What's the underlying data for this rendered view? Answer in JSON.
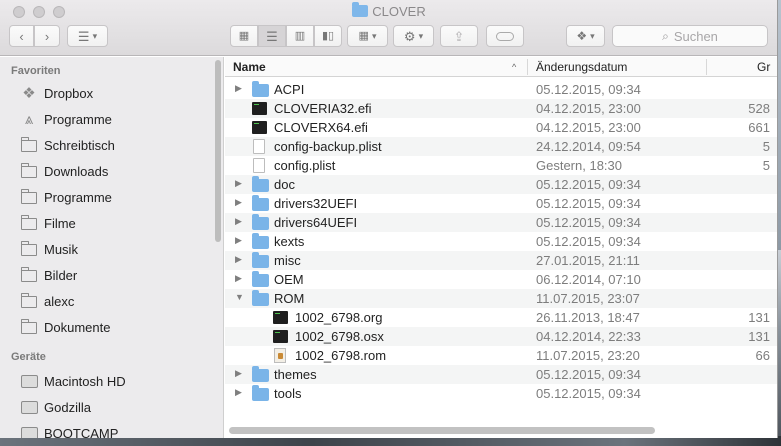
{
  "window": {
    "title": "CLOVER"
  },
  "toolbar": {
    "search_placeholder": "Suchen"
  },
  "sidebar": {
    "favorites_header": "Favoriten",
    "favorites": [
      {
        "label": "Dropbox",
        "icon": "dropbox-icon"
      },
      {
        "label": "Programme",
        "icon": "applications-icon"
      },
      {
        "label": "Schreibtisch",
        "icon": "folder-icon"
      },
      {
        "label": "Downloads",
        "icon": "folder-icon"
      },
      {
        "label": "Programme",
        "icon": "folder-icon"
      },
      {
        "label": "Filme",
        "icon": "folder-icon"
      },
      {
        "label": "Musik",
        "icon": "folder-icon"
      },
      {
        "label": "Bilder",
        "icon": "folder-icon"
      },
      {
        "label": "alexc",
        "icon": "folder-icon"
      },
      {
        "label": "Dokumente",
        "icon": "folder-icon"
      }
    ],
    "devices_header": "Geräte",
    "devices": [
      {
        "label": "Macintosh HD",
        "icon": "disk-icon"
      },
      {
        "label": "Godzilla",
        "icon": "disk-icon"
      },
      {
        "label": "BOOTCAMP",
        "icon": "disk-icon"
      }
    ]
  },
  "columns": {
    "name": "Name",
    "date": "Änderungsdatum",
    "size": "Gr"
  },
  "files": [
    {
      "name": "ACPI",
      "date": "05.12.2015, 09:34",
      "size": "",
      "type": "folder",
      "level": 0,
      "disclosure": "collapsed"
    },
    {
      "name": "CLOVERIA32.efi",
      "date": "04.12.2015, 23:00",
      "size": "528",
      "type": "exec",
      "level": 0,
      "disclosure": ""
    },
    {
      "name": "CLOVERX64.efi",
      "date": "04.12.2015, 23:00",
      "size": "661",
      "type": "exec",
      "level": 0,
      "disclosure": ""
    },
    {
      "name": "config-backup.plist",
      "date": "24.12.2014, 09:54",
      "size": "5",
      "type": "doc",
      "level": 0,
      "disclosure": ""
    },
    {
      "name": "config.plist",
      "date": "Gestern, 18:30",
      "size": "5",
      "type": "doc",
      "level": 0,
      "disclosure": ""
    },
    {
      "name": "doc",
      "date": "05.12.2015, 09:34",
      "size": "",
      "type": "folder",
      "level": 0,
      "disclosure": "collapsed"
    },
    {
      "name": "drivers32UEFI",
      "date": "05.12.2015, 09:34",
      "size": "",
      "type": "folder",
      "level": 0,
      "disclosure": "collapsed"
    },
    {
      "name": "drivers64UEFI",
      "date": "05.12.2015, 09:34",
      "size": "",
      "type": "folder",
      "level": 0,
      "disclosure": "collapsed"
    },
    {
      "name": "kexts",
      "date": "05.12.2015, 09:34",
      "size": "",
      "type": "folder",
      "level": 0,
      "disclosure": "collapsed"
    },
    {
      "name": "misc",
      "date": "27.01.2015, 21:11",
      "size": "",
      "type": "folder",
      "level": 0,
      "disclosure": "collapsed"
    },
    {
      "name": "OEM",
      "date": "06.12.2014, 07:10",
      "size": "",
      "type": "folder",
      "level": 0,
      "disclosure": "collapsed"
    },
    {
      "name": "ROM",
      "date": "11.07.2015, 23:07",
      "size": "",
      "type": "folder",
      "level": 0,
      "disclosure": "expanded"
    },
    {
      "name": "1002_6798.org",
      "date": "26.11.2013, 18:47",
      "size": "131",
      "type": "exec",
      "level": 1,
      "disclosure": ""
    },
    {
      "name": "1002_6798.osx",
      "date": "04.12.2014, 22:33",
      "size": "131",
      "type": "exec",
      "level": 1,
      "disclosure": ""
    },
    {
      "name": "1002_6798.rom",
      "date": "11.07.2015, 23:20",
      "size": "66",
      "type": "rom",
      "level": 1,
      "disclosure": ""
    },
    {
      "name": "themes",
      "date": "05.12.2015, 09:34",
      "size": "",
      "type": "folder",
      "level": 0,
      "disclosure": "collapsed"
    },
    {
      "name": "tools",
      "date": "05.12.2015, 09:34",
      "size": "",
      "type": "folder",
      "level": 0,
      "disclosure": "collapsed"
    }
  ],
  "colors": {
    "folder": "#7ab4e8",
    "alt_row": "#f4f5f5",
    "sidebar_bg": "#ecebed"
  }
}
